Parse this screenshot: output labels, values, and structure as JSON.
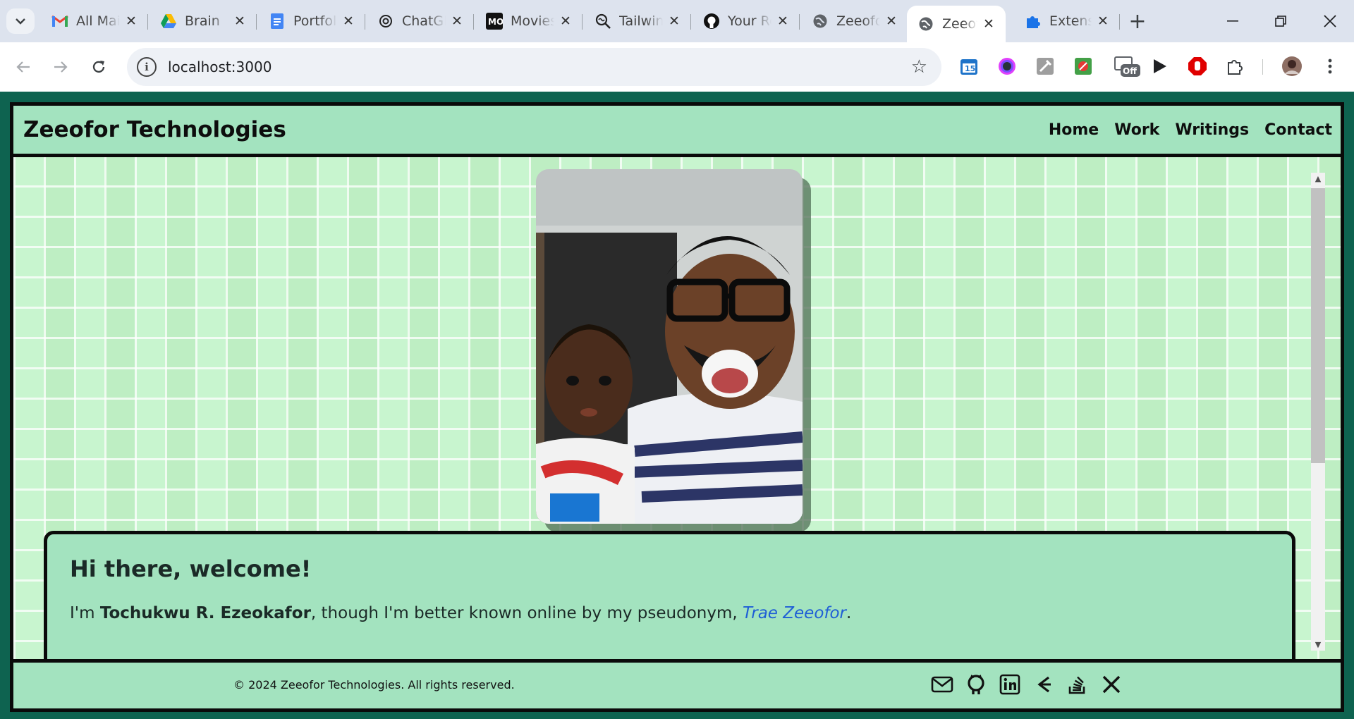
{
  "browser": {
    "tabs": [
      {
        "title": "All Mail",
        "icon": "gmail-icon"
      },
      {
        "title": "Brain",
        "icon": "google-drive-icon"
      },
      {
        "title": "Portfolio",
        "icon": "google-docs-icon"
      },
      {
        "title": "ChatGPT",
        "icon": "openai-icon"
      },
      {
        "title": "Movies",
        "icon": "movie-app-icon"
      },
      {
        "title": "Tailwind",
        "icon": "tailwind-search-icon"
      },
      {
        "title": "Your Repositories",
        "icon": "github-icon"
      },
      {
        "title": "Zeeofor",
        "icon": "globe-icon"
      },
      {
        "title": "Zeeofor",
        "icon": "globe-icon",
        "active": true
      },
      {
        "title": "Extensions",
        "icon": "puzzle-icon"
      }
    ],
    "url": "localhost:3000",
    "extension_badge": "Off"
  },
  "site": {
    "brand": "Zeeofor Technologies",
    "nav": [
      "Home",
      "Work",
      "Writings",
      "Contact"
    ],
    "welcome": {
      "heading": "Hi there, welcome!",
      "intro_prefix": "I'm ",
      "name": "Tochukwu R. Ezeokafor",
      "intro_middle": ", though I'm better known online by my pseudonym, ",
      "pseudonym": "Trae Zeeofor",
      "intro_suffix": "."
    },
    "footer": {
      "copyright": "© 2024 Zeeofor Technologies. All rights reserved.",
      "socials": [
        "mail-icon",
        "github-icon",
        "linkedin-icon",
        "codewars-icon",
        "stackoverflow-icon",
        "x-icon"
      ]
    }
  },
  "colors": {
    "page_bg": "#0e6350",
    "header_bg": "#a3e3bf",
    "tile_bg": "#c8f5cf",
    "link": "#1f5fd6"
  }
}
